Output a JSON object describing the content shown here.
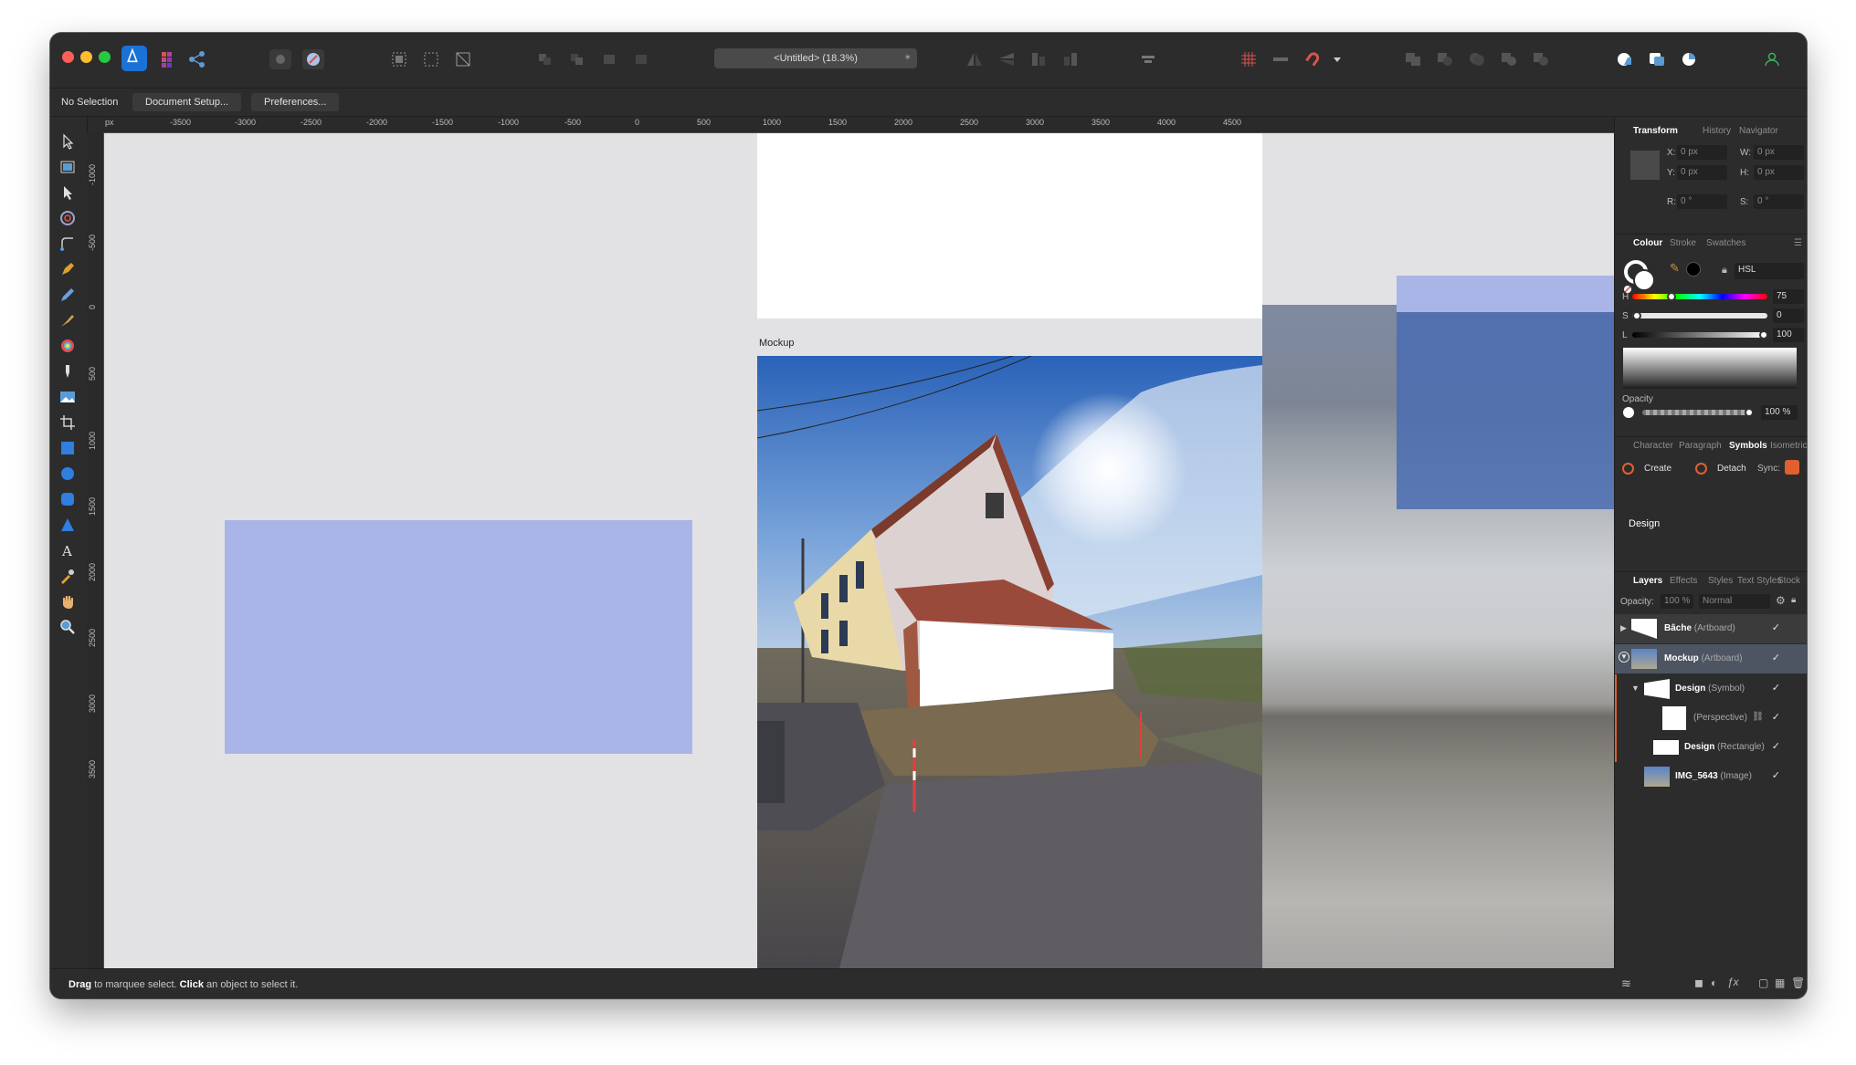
{
  "toolbar": {
    "document_title": "<Untitled> (18.3%)",
    "app": "Affinity Designer"
  },
  "context_bar": {
    "selection_status": "No Selection",
    "document_setup": "Document Setup...",
    "preferences": "Preferences..."
  },
  "rulers": {
    "unit": "px",
    "top_labels": [
      "-3500",
      "-3000",
      "-2500",
      "-2000",
      "-1500",
      "-1000",
      "-500",
      "0",
      "500",
      "1000",
      "1500",
      "2000",
      "2500",
      "3000",
      "3500",
      "4000",
      "4500"
    ],
    "left_labels": [
      "-1000",
      "-500",
      "0",
      "500",
      "1000",
      "1500",
      "2000",
      "2500",
      "3000",
      "3500"
    ]
  },
  "canvas": {
    "artboard_label": "Mockup"
  },
  "transform_panel": {
    "tabs": [
      "Transform",
      "History",
      "Navigator"
    ],
    "x_label": "X:",
    "x_value": "0 px",
    "y_label": "Y:",
    "y_value": "0 px",
    "w_label": "W:",
    "w_value": "0 px",
    "h_label": "H:",
    "h_value": "0 px",
    "r_label": "R:",
    "r_value": "0 °",
    "s_label": "S:",
    "s_value": "0 °"
  },
  "colour_panel": {
    "tabs": [
      "Colour",
      "Stroke",
      "Swatches"
    ],
    "model": "HSL",
    "h_label": "H",
    "h_value": "75",
    "s_label": "S",
    "s_value": "0",
    "l_label": "L",
    "l_value": "100",
    "opacity_label": "Opacity",
    "opacity_value": "100 %"
  },
  "symbols_panel": {
    "tabs": [
      "Character",
      "Paragraph",
      "Symbols",
      "Isometric"
    ],
    "create": "Create",
    "detach": "Detach",
    "sync": "Sync:",
    "symbol_name": "Design"
  },
  "layers_panel": {
    "tabs": [
      "Layers",
      "Effects",
      "Styles",
      "Text Styles",
      "Stock"
    ],
    "opacity_label": "Opacity:",
    "opacity_value": "100 %",
    "blend_mode": "Normal",
    "layers": [
      {
        "name": "Bâche",
        "type": "(Artboard)"
      },
      {
        "name": "Mockup",
        "type": "(Artboard)"
      },
      {
        "name": "Design",
        "type": "(Symbol)"
      },
      {
        "name": "",
        "type": "(Perspective)"
      },
      {
        "name": "Design",
        "type": "(Rectangle)"
      },
      {
        "name": "IMG_5643",
        "type": "(Image)"
      }
    ]
  },
  "status_bar": {
    "action1": "Drag",
    "text1": " to marquee select. ",
    "action2": "Click",
    "text2": " an object to select it."
  },
  "colors": {
    "accent_blue": "#a8b5e6",
    "photo_overlay": "#4a6cb0",
    "selection": "#4d5563"
  }
}
